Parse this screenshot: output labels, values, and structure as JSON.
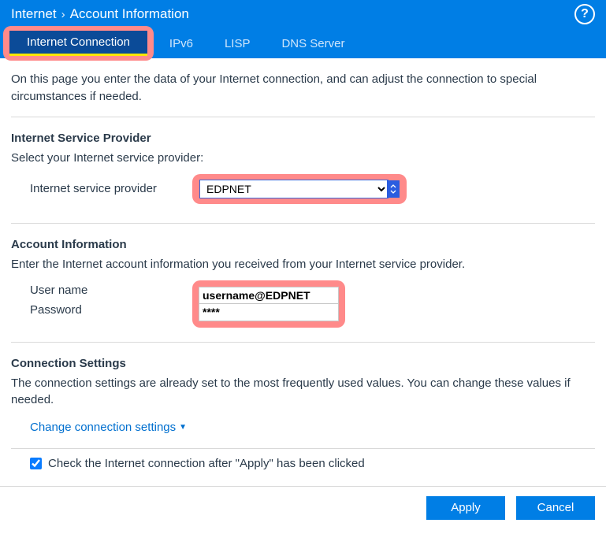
{
  "breadcrumb": {
    "root": "Internet",
    "page": "Account Information"
  },
  "help": {
    "tooltip": "Help"
  },
  "tabs": [
    {
      "label": "Internet Connection",
      "active": true
    },
    {
      "label": "IPv6",
      "active": false
    },
    {
      "label": "LISP",
      "active": false
    },
    {
      "label": "DNS Server",
      "active": false
    }
  ],
  "intro": "On this page you enter the data of your Internet connection, and can adjust the connection to special circumstances if needed.",
  "isp": {
    "title": "Internet Service Provider",
    "subtitle": "Select your Internet service provider:",
    "label": "Internet service provider",
    "selected": "EDPNET"
  },
  "account": {
    "title": "Account Information",
    "subtitle": "Enter the Internet account information you received from your Internet service provider.",
    "user_label": "User name",
    "user_value": "username@EDPNET",
    "pass_label": "Password",
    "pass_value": "****"
  },
  "conn": {
    "title": "Connection Settings",
    "subtitle": "The connection settings are already set to the most frequently used values. You can change these values if needed.",
    "link": "Change connection settings"
  },
  "check": {
    "label": "Check the Internet connection after \"Apply\" has been clicked",
    "checked": true
  },
  "buttons": {
    "apply": "Apply",
    "cancel": "Cancel"
  }
}
